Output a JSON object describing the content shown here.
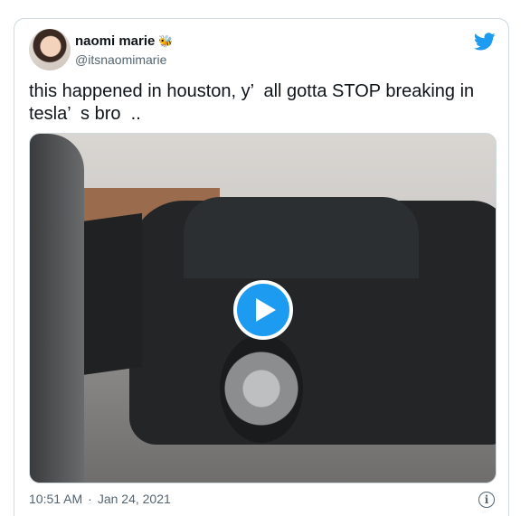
{
  "tweet": {
    "author_name": "naomi marie",
    "author_emoji": "🐝",
    "author_handle": "@itsnaomimarie",
    "text": "this happened in houston, y’  all gotta STOP breaking in\ntesla’  s bro  ..",
    "time": "10:51 AM",
    "separator": "·",
    "date": "Jan 24, 2021"
  },
  "icons": {
    "brand": "twitter-bird-icon",
    "play": "play-icon",
    "info": "info-icon"
  },
  "colors": {
    "brand": "#1d9bf0",
    "secondary_text": "#536471",
    "border": "#cfd9de"
  }
}
